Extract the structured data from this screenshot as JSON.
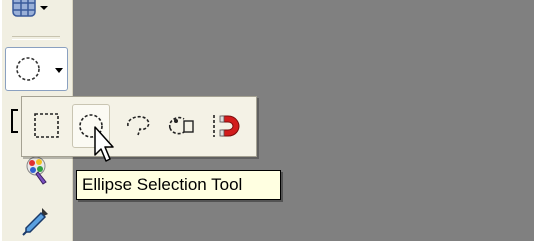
{
  "window": {
    "canvas_color": "#808080"
  },
  "toolbox": {
    "tools": [
      {
        "name": "grid-tool-icon"
      },
      {
        "name": "ellipse-select-active-icon"
      },
      {
        "name": "bracket-partial-icon"
      },
      {
        "name": "color-picker-icon"
      },
      {
        "name": "eyedropper-icon"
      }
    ]
  },
  "selection_flyout": {
    "items": [
      {
        "name": "rectangle-selection-icon",
        "state": "normal"
      },
      {
        "name": "ellipse-selection-icon",
        "state": "hovered"
      },
      {
        "name": "lasso-selection-icon",
        "state": "normal"
      },
      {
        "name": "polygon-lasso-selection-icon",
        "state": "normal"
      },
      {
        "name": "magnetic-selection-icon",
        "state": "normal"
      }
    ]
  },
  "tooltip": {
    "text": "Ellipse Selection Tool"
  },
  "colors": {
    "tooltip_bg": "#ffffe1",
    "magnet_red": "#d21c1c",
    "toolbox_bg": "#f1efe2"
  }
}
